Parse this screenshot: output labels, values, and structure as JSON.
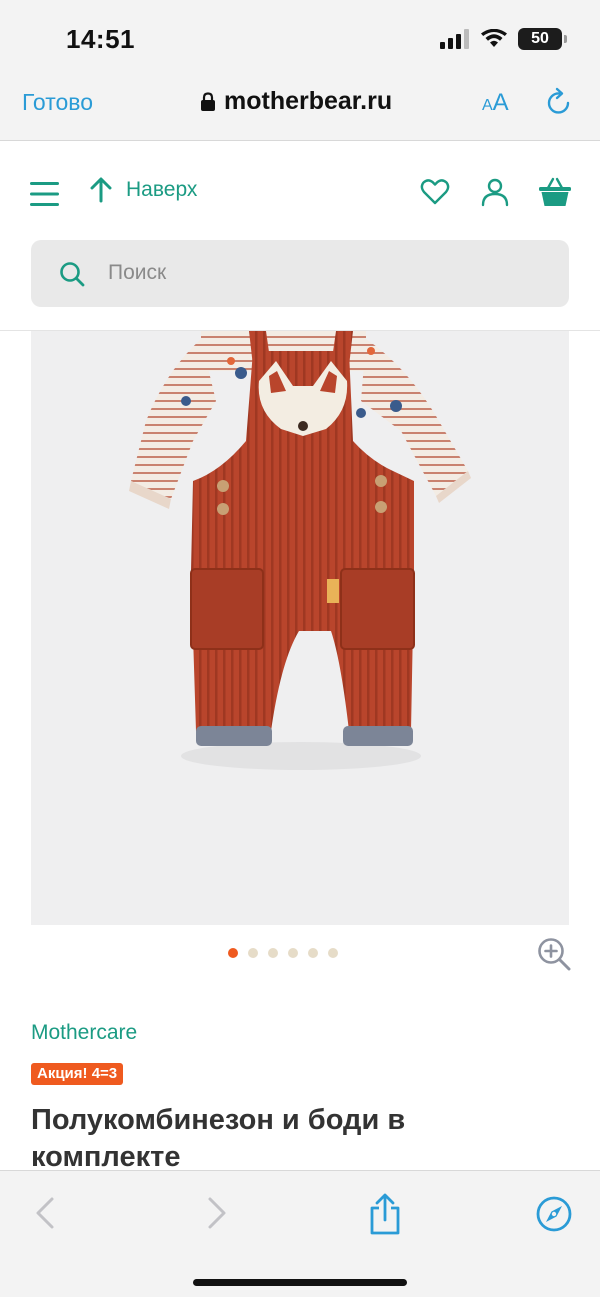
{
  "status": {
    "time": "14:51",
    "battery": "50"
  },
  "safari": {
    "done": "Готово",
    "url": "motherbear.ru",
    "aa_small": "A",
    "aa_large": "A"
  },
  "header": {
    "up_label": "Наверх"
  },
  "search": {
    "placeholder": "Поиск"
  },
  "gallery": {
    "slide_count": 6,
    "active_slide": 1
  },
  "product": {
    "brand": "Mothercare",
    "promo": "Акция! 4=3",
    "title": "Полукомбинезон и боди в комплекте"
  },
  "colors": {
    "accent": "#1b9b83",
    "safari_blue": "#2a9bd6",
    "promo": "#ef5a1f",
    "overall": "#b9452c"
  },
  "icons": {
    "menu": "hamburger-menu-icon",
    "up": "arrow-up-icon",
    "wishlist": "heart-icon",
    "account": "user-icon",
    "cart": "basket-icon",
    "search": "search-icon",
    "zoom": "zoom-in-icon",
    "lock": "lock-icon",
    "reload": "reload-icon",
    "back": "back-chevron-icon",
    "forward": "forward-chevron-icon",
    "share": "share-icon",
    "compass": "compass-icon"
  }
}
